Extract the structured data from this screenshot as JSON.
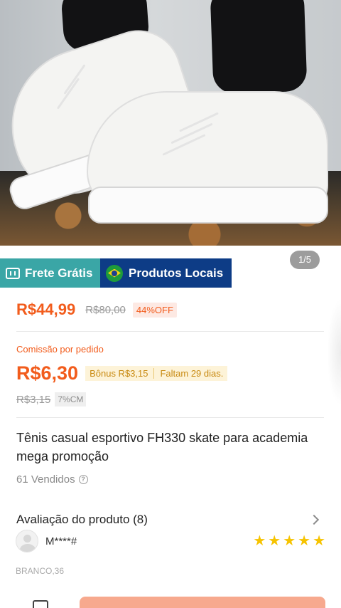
{
  "gallery": {
    "counter": "1/5",
    "image_alt": "tenis branco"
  },
  "badges": {
    "free_shipping": "Frete Grátis",
    "local_products": "Produtos Locais"
  },
  "pricing": {
    "price": "R$44,99",
    "original_price": "R$80,00",
    "discount": "44%OFF"
  },
  "commission": {
    "label": "Comissão por pedido",
    "amount": "R$6,30",
    "bonus": "Bônus R$3,15",
    "deadline": "Faltam 29 dias.",
    "original_amount": "R$3,15",
    "rate_tag": "7%CM"
  },
  "product": {
    "title": "Tênis casual esportivo FH330 skate para academia mega promoção",
    "sold": "61 Vendidos"
  },
  "reviews": {
    "title": "Avaliação do produto (8)",
    "reviewer_name": "M****#",
    "rating": 5,
    "variant": "BRANCO,36"
  },
  "colors": {
    "accent": "#f25c1c",
    "free_shipping_bg": "#3aa6a6",
    "local_products_bg": "#0d3c86",
    "star": "#f6c300"
  }
}
